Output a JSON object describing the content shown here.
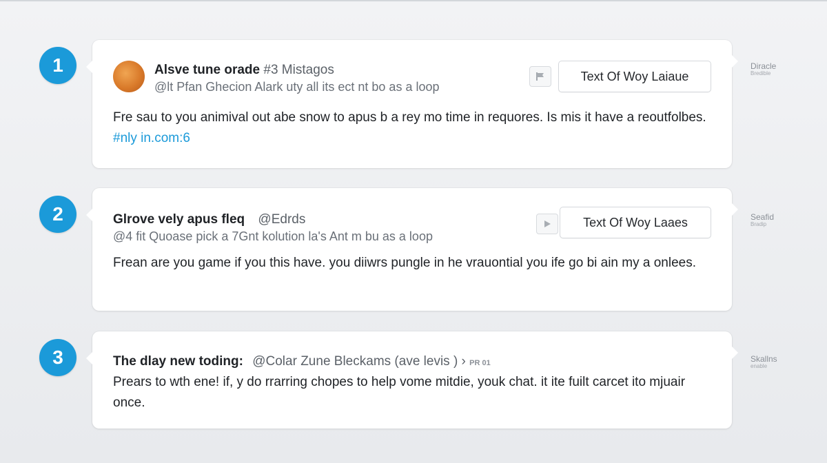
{
  "items": [
    {
      "number": "1",
      "title": "Alsve tune orade",
      "title_tag": "#3 Mistagos",
      "handle": "@lt Pfan Ghecion Alark uty all its ect nt bo as a loop",
      "body": "Fre sau to you animival out abe snow to apus b a rey mo time in requores. Is mis it have a reoutfolbes.",
      "link": "#nly in.com:6",
      "action_label": "Text Of Woy Laiaue",
      "side_top": "Diracle",
      "side_bottom": "Bredible"
    },
    {
      "number": "2",
      "title": "Glrove vely apus fleq",
      "title_tag": "@Edrds",
      "handle": "@4 fit Quoase pick a 7Gnt kolution la's Ant m bu as a loop",
      "body": "Frean are you game if you this have. you diiwrs pungle in he vrauontial you ife go bi ain my a onlees.",
      "action_label": "Text Of Woy Laaes",
      "side_top": "Seafid",
      "side_bottom": "Bradip"
    },
    {
      "number": "3",
      "title": "The dlay new toding:",
      "title_tag": "@Colar Zune Bleckams (ave levis ) ›",
      "title_meta": "PR 01",
      "body": "Prears to wth ene! if, y do rrarring chopes to help vome mitdie, youk chat. it ite fuilt carcet ito mjuair once.",
      "side_top": "Skallns",
      "side_bottom": "enable"
    }
  ],
  "colors": {
    "badge": "#1b9ad9",
    "link": "#1b9ad9",
    "background": "#eceef1",
    "card": "#ffffff"
  },
  "icons": {
    "flag": "flag-icon",
    "play": "play-icon"
  }
}
